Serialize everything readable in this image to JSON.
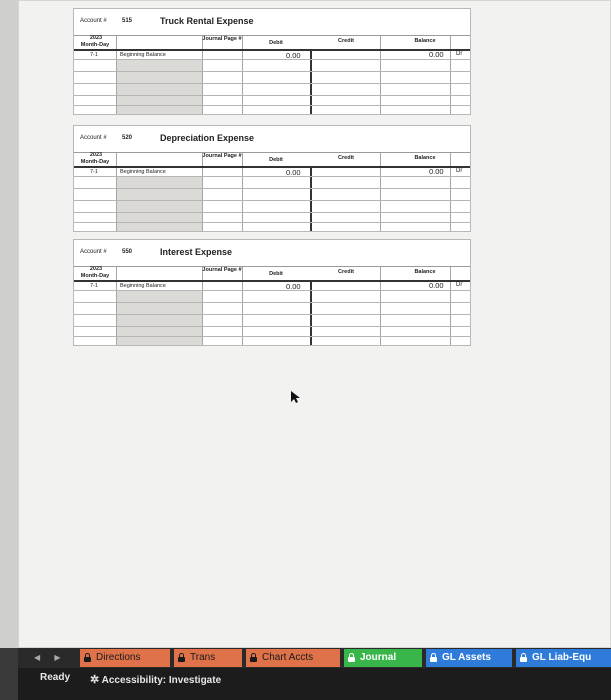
{
  "ledger_header": {
    "account_label": "Account #",
    "date_year": "2023",
    "date_sub": "Month-Day",
    "journal_page": "Journal Page #",
    "debit": "Debit",
    "credit": "Credit",
    "balance": "Balance"
  },
  "ledgers": [
    {
      "number": "515",
      "name": "Truck Rental Expense",
      "date": "7-1",
      "item": "Beginning Balance",
      "debit": "0.00",
      "balance": "0.00",
      "drcr": "Dr"
    },
    {
      "number": "520",
      "name": "Depreciation Expense",
      "date": "7-1",
      "item": "Beginning Balance",
      "debit": "0.00",
      "balance": "0.00",
      "drcr": "Dr"
    },
    {
      "number": "550",
      "name": "Interest Expense",
      "date": "7-1",
      "item": "Beginning Balance",
      "debit": "0.00",
      "balance": "0.00",
      "drcr": "Dr"
    }
  ],
  "tabs": [
    {
      "label": "Directions",
      "bg": "#e0724a",
      "fg": "#1a1a1a"
    },
    {
      "label": "Trans",
      "bg": "#e0724a",
      "fg": "#1a1a1a"
    },
    {
      "label": "Chart Accts",
      "bg": "#e0724a",
      "fg": "#1a1a1a"
    },
    {
      "label": "Journal",
      "bg": "#38b64a",
      "fg": "#ffffff"
    },
    {
      "label": "GL Assets",
      "bg": "#2f7bd9",
      "fg": "#ffffff"
    },
    {
      "label": "GL Liab-Equ",
      "bg": "#2f7bd9",
      "fg": "#ffffff"
    }
  ],
  "status": {
    "ready": "Ready",
    "accessibility": "Accessibility: Investigate"
  }
}
